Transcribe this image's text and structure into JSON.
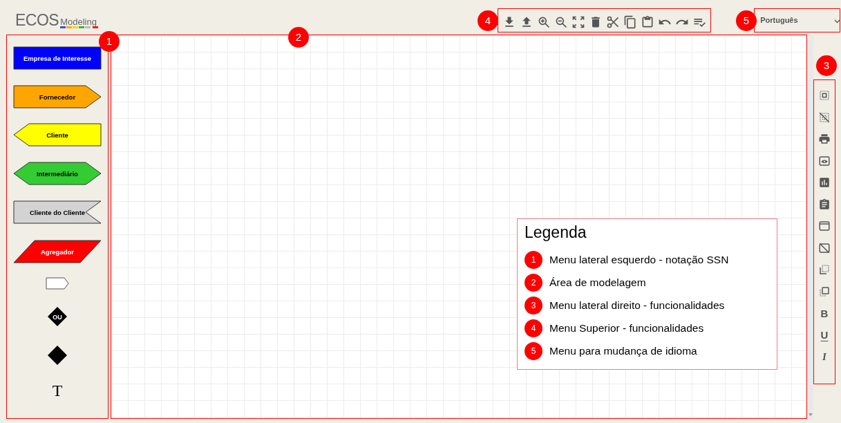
{
  "header": {
    "logo_main": "ECOS",
    "logo_sub": "Modeling"
  },
  "language_select": {
    "value": "Português"
  },
  "palette": [
    {
      "kind": "rect",
      "label": "Empresa de Interesse",
      "color": "#0000ff"
    },
    {
      "kind": "arrow_right",
      "label": "Fornecedor",
      "color": "#ffa500"
    },
    {
      "kind": "arrow_left",
      "label": "Cliente",
      "color": "#ffff00"
    },
    {
      "kind": "hexagon",
      "label": "Intermediário",
      "color": "#33cc33"
    },
    {
      "kind": "notch",
      "label": "Cliente do Cliente",
      "color": "#d3d3d3"
    },
    {
      "kind": "parallelogram",
      "label": "Agregador",
      "color": "#ff0000"
    },
    {
      "kind": "tag"
    },
    {
      "kind": "diamond",
      "label": "OU"
    },
    {
      "kind": "diamond"
    },
    {
      "kind": "text",
      "label": "T"
    }
  ],
  "format_buttons": [
    {
      "kind": "bold",
      "glyph": "B"
    },
    {
      "kind": "underline",
      "glyph": "U"
    },
    {
      "kind": "italic",
      "glyph": "I"
    }
  ],
  "callouts": [
    {
      "number": "1"
    },
    {
      "number": "2"
    },
    {
      "number": "3"
    },
    {
      "number": "4"
    },
    {
      "number": "5"
    }
  ],
  "legend": {
    "title": "Legenda",
    "items": [
      {
        "number": "1",
        "text": "Menu lateral esquerdo - notação SSN"
      },
      {
        "number": "2",
        "text": "Área de modelagem"
      },
      {
        "number": "3",
        "text": "Menu lateral direito - funcionalidades"
      },
      {
        "number": "4",
        "text": "Menu Superior - funcionalidades"
      },
      {
        "number": "5",
        "text": "Menu para mudança de idioma"
      }
    ]
  }
}
